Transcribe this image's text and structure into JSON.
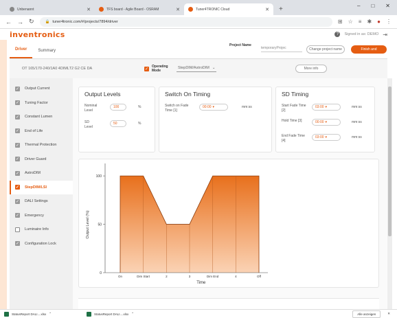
{
  "browser": {
    "tabs": [
      {
        "title": "Unbenannt",
        "favicon_color": "#888888"
      },
      {
        "title": "TFS board - Agile Board - OSRAM",
        "favicon_color": "#e55d12"
      },
      {
        "title": "Tuner4TRONIC Cloud",
        "favicon_color": "#e55d12"
      }
    ],
    "new_tab": "+",
    "url": "tuner4tronic.com/#/projects/7894/driver",
    "window_controls": [
      "–",
      "□",
      "✕"
    ]
  },
  "app": {
    "logo": "inventronics",
    "signed_in": "Signed in as: DEMO",
    "nav_tabs": [
      "Driver",
      "Summary"
    ],
    "project_label": "Project Name",
    "project_value": "temporaryProjec",
    "change_project": "Change project name",
    "finish_button": "Finish and"
  },
  "product": {
    "name": "OT 165/170-240/1A0 4DIMLT2 G2 CE DA",
    "operating_mode_label": "Operating Mode",
    "operating_mode_value": "StepDIM/AstroDIM",
    "more_info": "More info"
  },
  "sidebar": {
    "items": [
      {
        "label": "Output Current",
        "state": "grey"
      },
      {
        "label": "Tuning Factor",
        "state": "grey"
      },
      {
        "label": "Constant Lumen",
        "state": "grey"
      },
      {
        "label": "End of Life",
        "state": "grey"
      },
      {
        "label": "Thermal Protection",
        "state": "grey"
      },
      {
        "label": "Driver Guard",
        "state": "grey"
      },
      {
        "label": "AstroDIM",
        "state": "grey"
      },
      {
        "label": "StepDIM/LSI",
        "state": "on",
        "active": true
      },
      {
        "label": "DALI Settings",
        "state": "grey"
      },
      {
        "label": "Emergency",
        "state": "grey"
      },
      {
        "label": "Luminaire Info",
        "state": "off"
      },
      {
        "label": "Configuration Lock",
        "state": "grey"
      }
    ]
  },
  "output_levels": {
    "title": "Output Levels",
    "nominal_label": "Nominal Level",
    "nominal_value": "100",
    "sd_label": "SD Level",
    "sd_value": "50",
    "unit": "%"
  },
  "switch_on": {
    "title": "Switch On Timing",
    "label": "Switch on Fade Time [1]",
    "value": "00:00",
    "unit": "mm:ss"
  },
  "sd_timing": {
    "title": "SD Timing",
    "rows": [
      {
        "label": "Start Fade Time [2]",
        "value": "03:00",
        "unit": "mm:ss"
      },
      {
        "label": "Hold Time [3]",
        "value": "00:00",
        "unit": "mm:ss"
      },
      {
        "label": "End Fade Time [4]",
        "value": "03:00",
        "unit": "mm:ss"
      }
    ]
  },
  "chart_data": {
    "type": "area",
    "ylabel": "Output Level (%)",
    "xlabel": "Time",
    "yticks": [
      0,
      50,
      100
    ],
    "ylim": [
      0,
      110
    ],
    "x_labels": [
      "On",
      "Dim Start",
      "2",
      "3",
      "Dim End",
      "4",
      "Off"
    ],
    "x": [
      0,
      1,
      2,
      3,
      4,
      5,
      6
    ],
    "values": [
      100,
      100,
      50,
      50,
      100,
      100,
      100
    ],
    "color": "#e55d12"
  },
  "downloads": {
    "items": [
      "StatusReport DALI....xlsx",
      "StatusReport DALI....xlsx"
    ],
    "show_all": "Alle anzeigen",
    "close": "✕"
  },
  "colors": {
    "accent": "#e55d12"
  }
}
